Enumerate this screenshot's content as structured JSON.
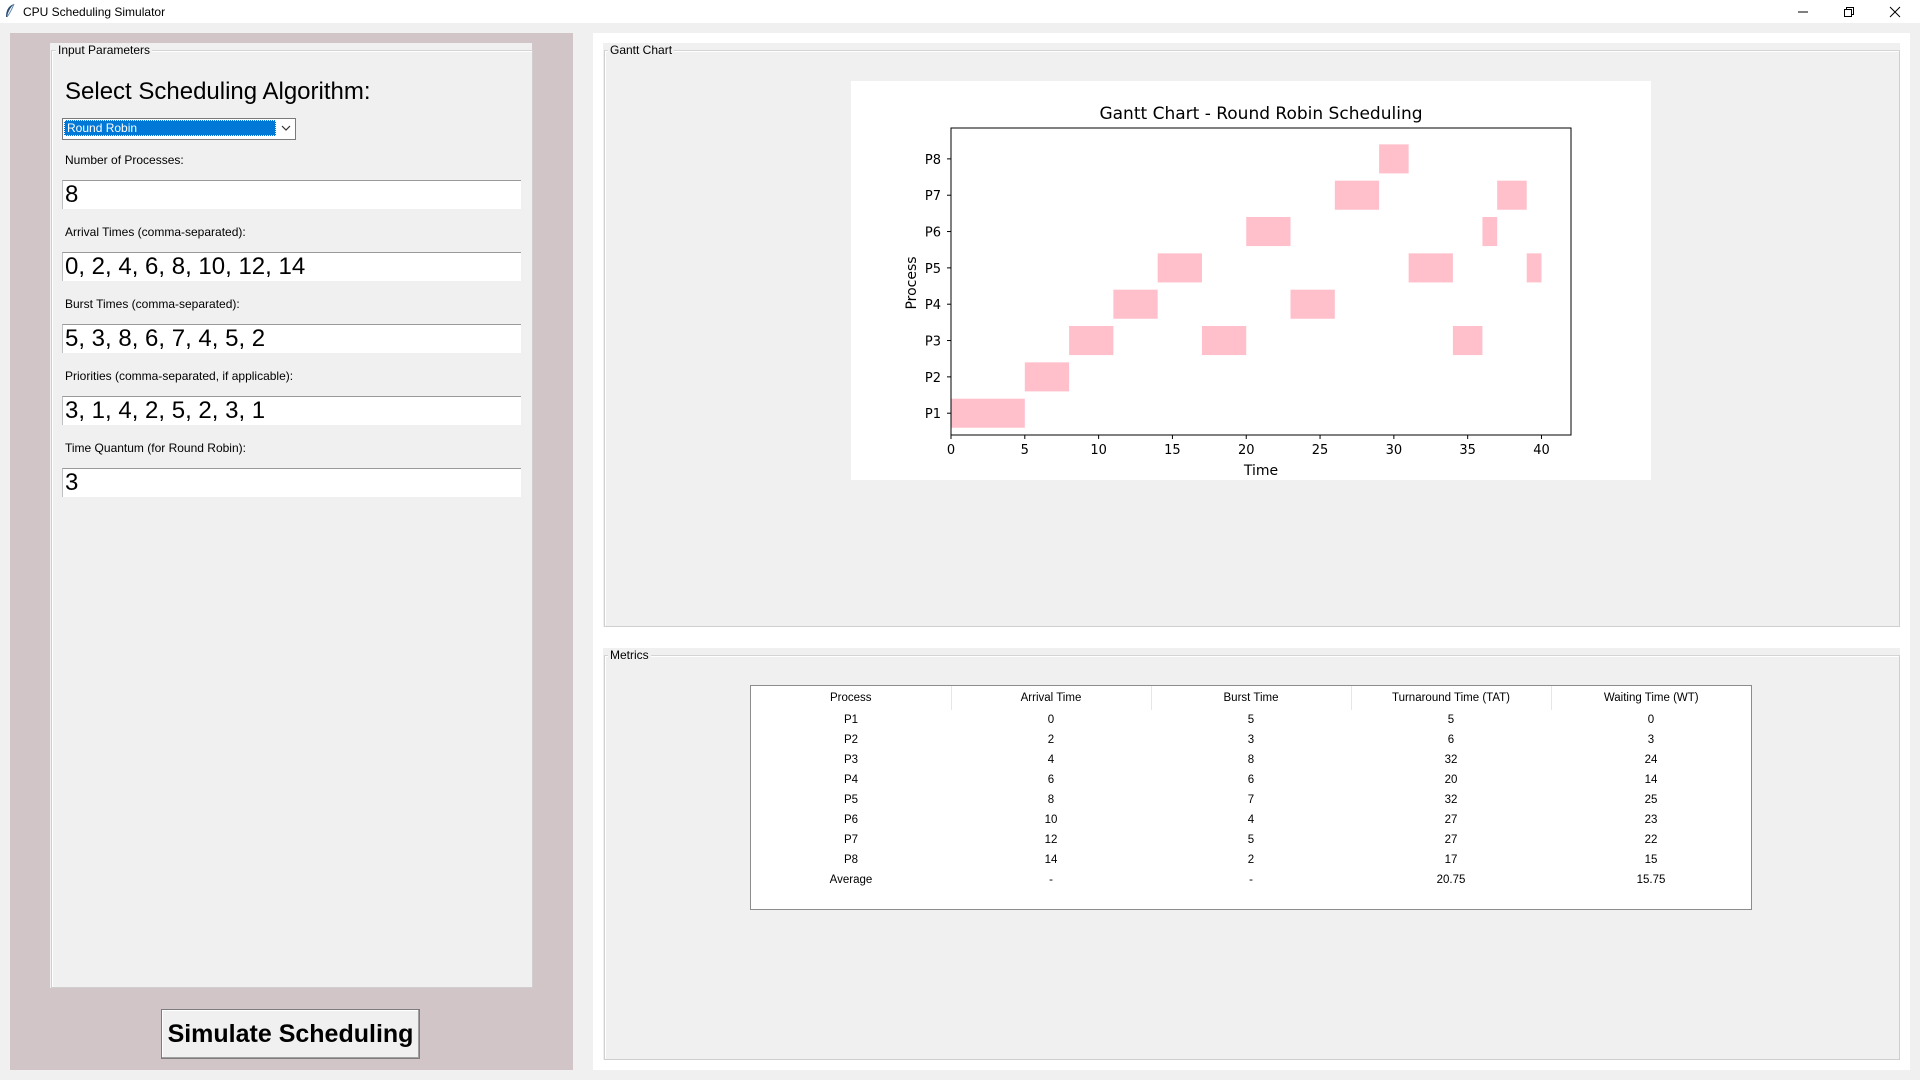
{
  "window": {
    "title": "CPU Scheduling Simulator"
  },
  "input": {
    "group_label": "Input Parameters",
    "heading": "Select Scheduling Algorithm:",
    "algorithm": "Round Robin",
    "num_processes_label": "Number of Processes:",
    "num_processes": "8",
    "arrival_label": "Arrival Times (comma-separated):",
    "arrival": "0, 2, 4, 6, 8, 10, 12, 14",
    "burst_label": "Burst Times (comma-separated):",
    "burst": "5, 3, 8, 6, 7, 4, 5, 2",
    "priority_label": "Priorities (comma-separated, if applicable):",
    "priority": "3, 1, 4, 2, 5, 2, 3, 1",
    "quantum_label": "Time Quantum (for Round Robin):",
    "quantum": "3",
    "simulate_label": "Simulate Scheduling"
  },
  "gantt": {
    "group_label": "Gantt Chart"
  },
  "chart_data": {
    "type": "bar",
    "orientation": "horizontal-gantt",
    "title": "Gantt Chart - Round Robin Scheduling",
    "xlabel": "Time",
    "ylabel": "Process",
    "xlim": [
      0,
      42
    ],
    "xticks": [
      "0",
      "5",
      "10",
      "15",
      "20",
      "25",
      "30",
      "35",
      "40"
    ],
    "categories": [
      "P1",
      "P2",
      "P3",
      "P4",
      "P5",
      "P6",
      "P7",
      "P8"
    ],
    "bar_color": "#ffc0cb",
    "segments": [
      {
        "process": "P1",
        "start": 0,
        "end": 5
      },
      {
        "process": "P2",
        "start": 5,
        "end": 8
      },
      {
        "process": "P3",
        "start": 8,
        "end": 11
      },
      {
        "process": "P4",
        "start": 11,
        "end": 14
      },
      {
        "process": "P5",
        "start": 14,
        "end": 17
      },
      {
        "process": "P3",
        "start": 17,
        "end": 20
      },
      {
        "process": "P6",
        "start": 20,
        "end": 23
      },
      {
        "process": "P4",
        "start": 23,
        "end": 26
      },
      {
        "process": "P7",
        "start": 26,
        "end": 29
      },
      {
        "process": "P8",
        "start": 29,
        "end": 31
      },
      {
        "process": "P5",
        "start": 31,
        "end": 34
      },
      {
        "process": "P3",
        "start": 34,
        "end": 36
      },
      {
        "process": "P6",
        "start": 36,
        "end": 37
      },
      {
        "process": "P7",
        "start": 37,
        "end": 39
      },
      {
        "process": "P5",
        "start": 39,
        "end": 40
      }
    ]
  },
  "metrics": {
    "group_label": "Metrics",
    "columns": [
      "Process",
      "Arrival Time",
      "Burst Time",
      "Turnaround Time (TAT)",
      "Waiting Time (WT)"
    ],
    "rows": [
      [
        "P1",
        "0",
        "5",
        "5",
        "0"
      ],
      [
        "P2",
        "2",
        "3",
        "6",
        "3"
      ],
      [
        "P3",
        "4",
        "8",
        "32",
        "24"
      ],
      [
        "P4",
        "6",
        "6",
        "20",
        "14"
      ],
      [
        "P5",
        "8",
        "7",
        "32",
        "25"
      ],
      [
        "P6",
        "10",
        "4",
        "27",
        "23"
      ],
      [
        "P7",
        "12",
        "5",
        "27",
        "22"
      ],
      [
        "P8",
        "14",
        "2",
        "17",
        "15"
      ],
      [
        "Average",
        "-",
        "-",
        "20.75",
        "15.75"
      ]
    ]
  }
}
